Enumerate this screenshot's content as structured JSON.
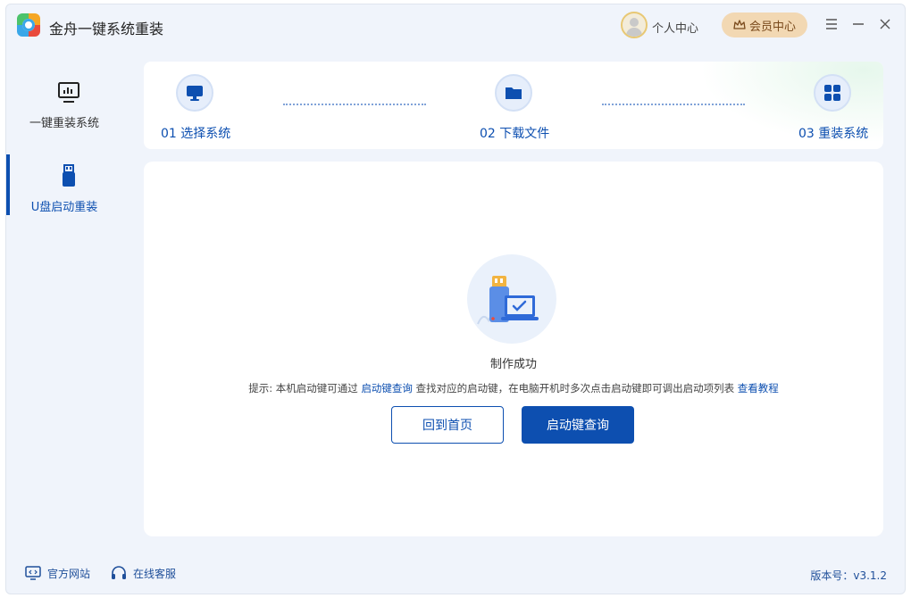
{
  "app": {
    "title": "金舟一键系统重装"
  },
  "header": {
    "user_center": "个人中心",
    "vip_center": "会员中心"
  },
  "sidebar": {
    "items": [
      {
        "label": "一键重装系统",
        "icon": "monitor-chart-icon"
      },
      {
        "label": "U盘启动重装",
        "icon": "usb-drive-icon"
      }
    ]
  },
  "steps": [
    {
      "label": "01 选择系统",
      "icon": "monitor-icon"
    },
    {
      "label": "02 下载文件",
      "icon": "folder-icon"
    },
    {
      "label": "03 重装系统",
      "icon": "grid-icon"
    }
  ],
  "main": {
    "status": "制作成功",
    "hint": {
      "prefix": "提示: 本机启动键可通过",
      "link1": "启动键查询",
      "middle": "查找对应的启动键，在电脑开机时多次点击启动键即可调出启动项列表",
      "link2": "查看教程"
    },
    "buttons": {
      "home": "回到首页",
      "query": "启动键查询"
    }
  },
  "footer": {
    "website": "官方网站",
    "service": "在线客服",
    "version": "版本号：v3.1.2"
  },
  "colors": {
    "accent": "#0d4fb0",
    "vip_bg": "#f2d8b3",
    "window_bg": "#f0f4fb"
  }
}
